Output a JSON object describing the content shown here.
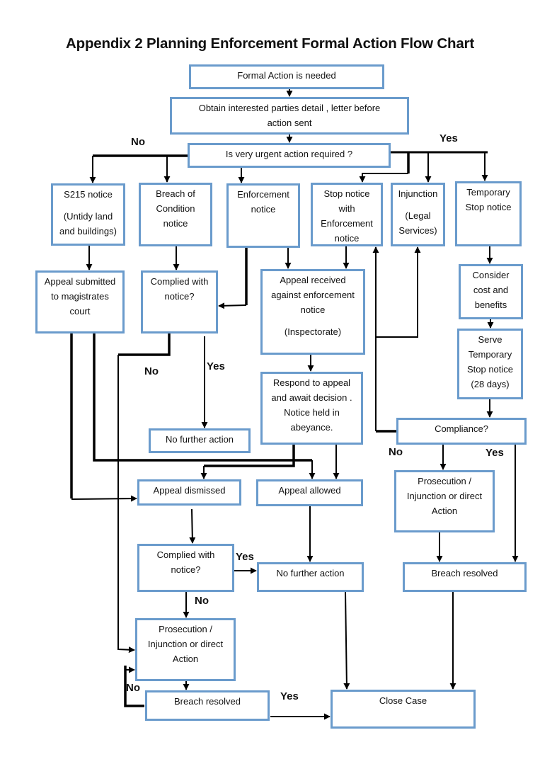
{
  "title": "Appendix 2 Planning Enforcement Formal Action Flow Chart",
  "nodes": {
    "formal_action": {
      "lines": [
        "Formal Action is needed"
      ]
    },
    "obtain_parties": {
      "lines": [
        "Obtain interested parties detail , letter before",
        "action sent"
      ]
    },
    "urgent_question": {
      "lines": [
        "Is very urgent action required ?"
      ]
    },
    "s215": {
      "lines": [
        "S215 notice",
        "",
        "(Untidy land",
        "and buildings)"
      ]
    },
    "breach_condition": {
      "lines": [
        "Breach of",
        "Condition",
        "notice"
      ]
    },
    "enforcement_notice": {
      "lines": [
        "Enforcement",
        "notice"
      ]
    },
    "stop_notice": {
      "lines": [
        "Stop notice",
        "with",
        "Enforcement",
        "notice"
      ]
    },
    "injunction": {
      "lines": [
        "Injunction",
        "",
        "(Legal",
        "Services)"
      ]
    },
    "temp_stop": {
      "lines": [
        "Temporary",
        "Stop notice"
      ]
    },
    "appeal_magistrates": {
      "lines": [
        "Appeal submitted",
        "to magistrates",
        "court"
      ]
    },
    "complied_1": {
      "lines": [
        "Complied with",
        "notice?"
      ]
    },
    "appeal_received": {
      "lines": [
        "Appeal received",
        "against enforcement",
        "notice",
        "",
        "(Inspectorate)"
      ]
    },
    "consider_cost": {
      "lines": [
        "Consider",
        "cost  and",
        "benefits"
      ]
    },
    "serve_temp": {
      "lines": [
        "Serve",
        "Temporary",
        "Stop notice",
        "(28 days)"
      ]
    },
    "respond_appeal": {
      "lines": [
        "Respond to appeal",
        "and await decision .",
        "Notice held in",
        "abeyance."
      ]
    },
    "no_further_1": {
      "lines": [
        "No further action"
      ]
    },
    "compliance": {
      "lines": [
        "Compliance?"
      ]
    },
    "appeal_dismissed": {
      "lines": [
        "Appeal dismissed"
      ]
    },
    "appeal_allowed": {
      "lines": [
        "Appeal allowed"
      ]
    },
    "prosecution_right": {
      "lines": [
        "Prosecution /",
        "Injunction  or direct",
        "Action"
      ]
    },
    "complied_2": {
      "lines": [
        "Complied with",
        "notice?"
      ]
    },
    "no_further_2": {
      "lines": [
        "No further action"
      ]
    },
    "breach_resolved_right": {
      "lines": [
        "Breach resolved"
      ]
    },
    "prosecution_left": {
      "lines": [
        "Prosecution /",
        "Injunction  or direct",
        "Action"
      ]
    },
    "breach_resolved_left": {
      "lines": [
        "Breach resolved"
      ]
    },
    "close_case": {
      "lines": [
        "Close Case"
      ]
    }
  },
  "labels": {
    "urgent_no": "No",
    "urgent_yes": "Yes",
    "complied1_no": "No",
    "complied1_yes": "Yes",
    "compliance_no": "No",
    "compliance_yes": "Yes",
    "complied2_yes": "Yes",
    "complied2_no": "No",
    "breach_no": "No",
    "breach_yes": "Yes"
  },
  "colors": {
    "box_border": "#6a9bcc",
    "line": "#000000"
  }
}
